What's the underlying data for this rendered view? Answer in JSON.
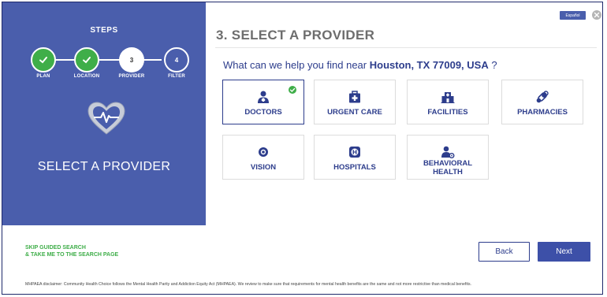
{
  "steps": {
    "title": "STEPS",
    "items": [
      {
        "number": "",
        "label": "PLAN",
        "state": "done"
      },
      {
        "number": "",
        "label": "LOCATION",
        "state": "done"
      },
      {
        "number": "3",
        "label": "PROVIDER",
        "state": "current"
      },
      {
        "number": "4",
        "label": "FILTER",
        "state": "todo"
      }
    ]
  },
  "left_panel": {
    "heading": "SELECT A PROVIDER",
    "icon": "heart-pulse-icon"
  },
  "header": {
    "title": "3. SELECT A PROVIDER",
    "language_button": "Español"
  },
  "question": {
    "prefix": "What can we help you find near ",
    "location": "Houston, TX 77009, USA",
    "suffix": " ?"
  },
  "providers": [
    {
      "label": "DOCTORS",
      "icon": "doctor-icon",
      "selected": true
    },
    {
      "label": "URGENT CARE",
      "icon": "first-aid-kit-icon",
      "selected": false
    },
    {
      "label": "FACILITIES",
      "icon": "hospital-building-icon",
      "selected": false
    },
    {
      "label": "PHARMACIES",
      "icon": "pills-icon",
      "selected": false
    },
    {
      "label": "VISION",
      "icon": "eye-icon",
      "selected": false
    },
    {
      "label": "HOSPITALS",
      "icon": "hospital-sign-icon",
      "selected": false
    },
    {
      "label": "BEHAVIORAL HEALTH",
      "icon": "behavioral-health-icon",
      "selected": false
    }
  ],
  "footer": {
    "skip_line1": "SKIP GUIDED SEARCH",
    "skip_line2": "& TAKE ME TO THE SEARCH PAGE",
    "back_label": "Back",
    "next_label": "Next",
    "disclaimer": "MHPAEA disclaimer: Community Health Choice follows the Mental Health Parity and Addiction Equity Act (MHPAEA). We review to make sure that requirements for mental health benefits are the same and not more restrictive than medical benefits."
  },
  "colors": {
    "panel_blue": "#4a5eac",
    "text_blue": "#2d3d8c",
    "step_green": "#3fae49"
  }
}
